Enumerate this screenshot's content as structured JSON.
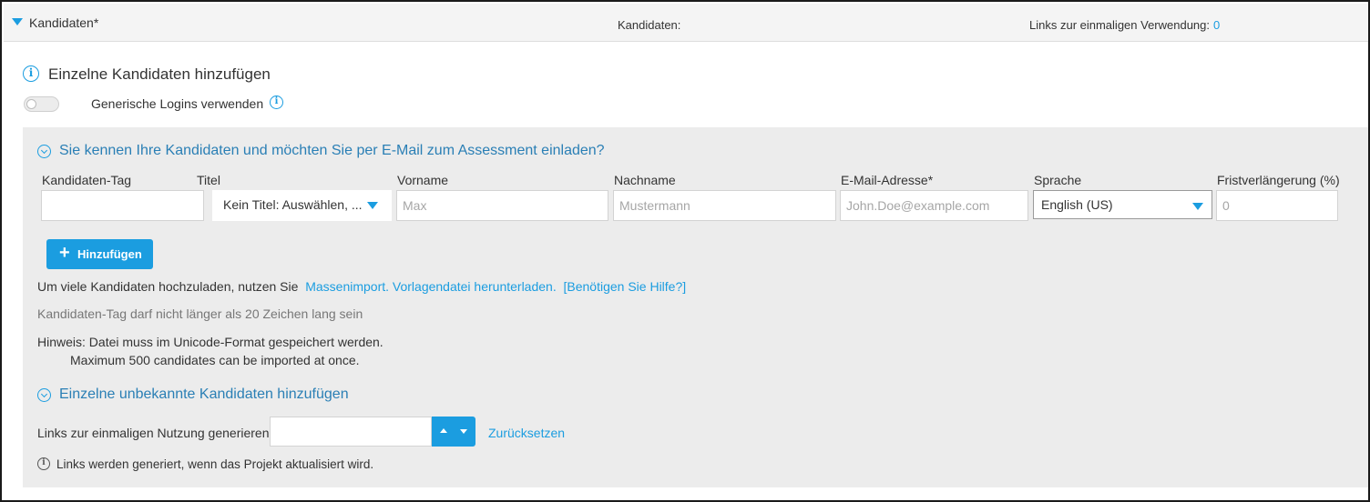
{
  "header": {
    "title": "Kandidaten*",
    "center_label": "Kandidaten:",
    "links_label": "Links zur einmaligen Verwendung:",
    "links_count": "0"
  },
  "section": {
    "title": "Einzelne Kandidaten hinzufügen",
    "toggle_label": "Generische Logins verwenden",
    "toggle_on": false
  },
  "invite": {
    "title": "Sie kennen Ihre Kandidaten und möchten Sie per E-Mail zum Assessment einladen?",
    "columns": {
      "tag": "Kandidaten-Tag",
      "title": "Titel",
      "firstname": "Vorname",
      "lastname": "Nachname",
      "email": "E-Mail-Adresse*",
      "language": "Sprache",
      "extension": "Fristverlängerung (%)"
    },
    "values": {
      "tag": "",
      "title_selected": "Kein Titel: Auswählen, ...",
      "language_selected": "English (US)"
    },
    "placeholders": {
      "firstname": "Max",
      "lastname": "Mustermann",
      "email": "John.Doe@example.com",
      "extension": "0"
    },
    "add_button": "Hinzufügen"
  },
  "upload": {
    "prefix": "Um viele Kandidaten hochzuladen, nutzen Sie",
    "mass_import_link": "Massenimport.",
    "template_link": "Vorlagendatei herunterladen.",
    "help_link": "[Benötigen Sie Hilfe?]"
  },
  "notes": {
    "tag_limit": "Kandidaten-Tag darf nicht länger als 20 Zeichen lang sein",
    "unicode_hint": "Hinweis: Datei muss im Unicode-Format gespeichert werden.",
    "max_candidates": "Maximum 500 candidates can be imported at once."
  },
  "unknown": {
    "title": "Einzelne unbekannte Kandidaten hinzufügen",
    "generate_label": "Links zur einmaligen Nutzung generieren",
    "generate_value": "",
    "reset_link": "Zurücksetzen",
    "info_text": "Links werden generiert, wenn das Projekt aktualisiert wird."
  },
  "colors": {
    "accent": "#1b9de0",
    "panel_bg": "#ececec",
    "header_bg": "#f4f4f4"
  }
}
